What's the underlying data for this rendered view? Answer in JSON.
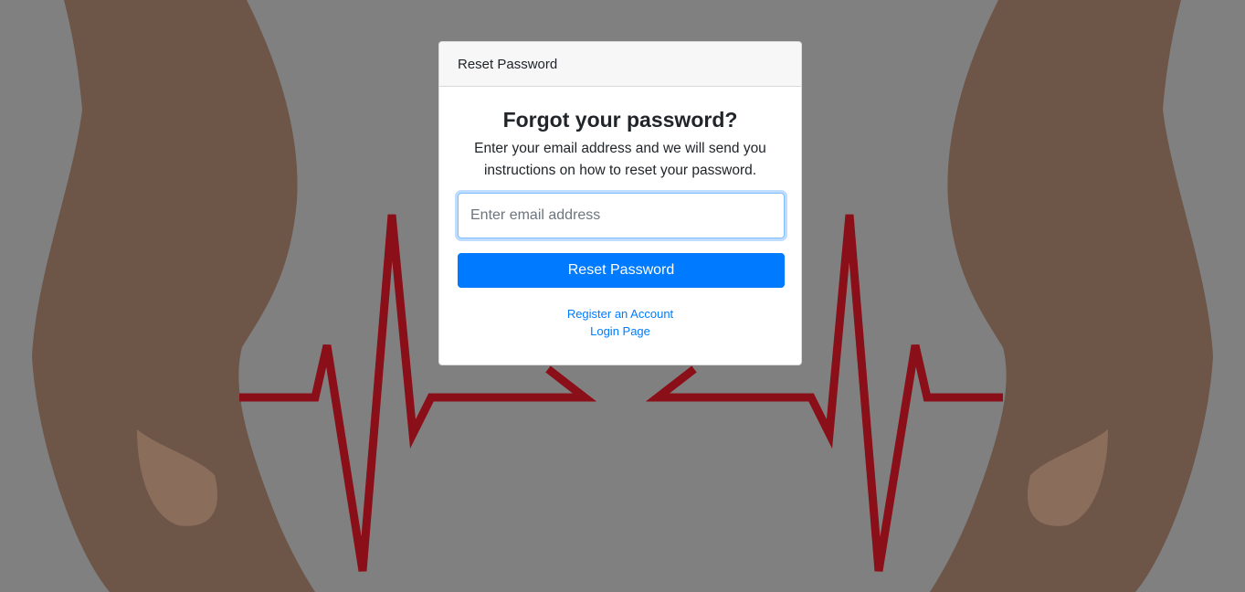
{
  "card": {
    "header": "Reset Password",
    "title": "Forgot your password?",
    "subtitle": "Enter your email address and we will send you instructions on how to reset your password.",
    "email_placeholder": "Enter email address",
    "email_value": "",
    "submit_label": "Reset Password",
    "links": {
      "register": "Register an Account",
      "login": "Login Page"
    }
  },
  "colors": {
    "overlay": "#808080",
    "primary": "#007bff",
    "heartbeat": "#8b0f18",
    "skin": "#7a5a48"
  },
  "background": {
    "description_icon": "hands-heartbeat-background"
  }
}
